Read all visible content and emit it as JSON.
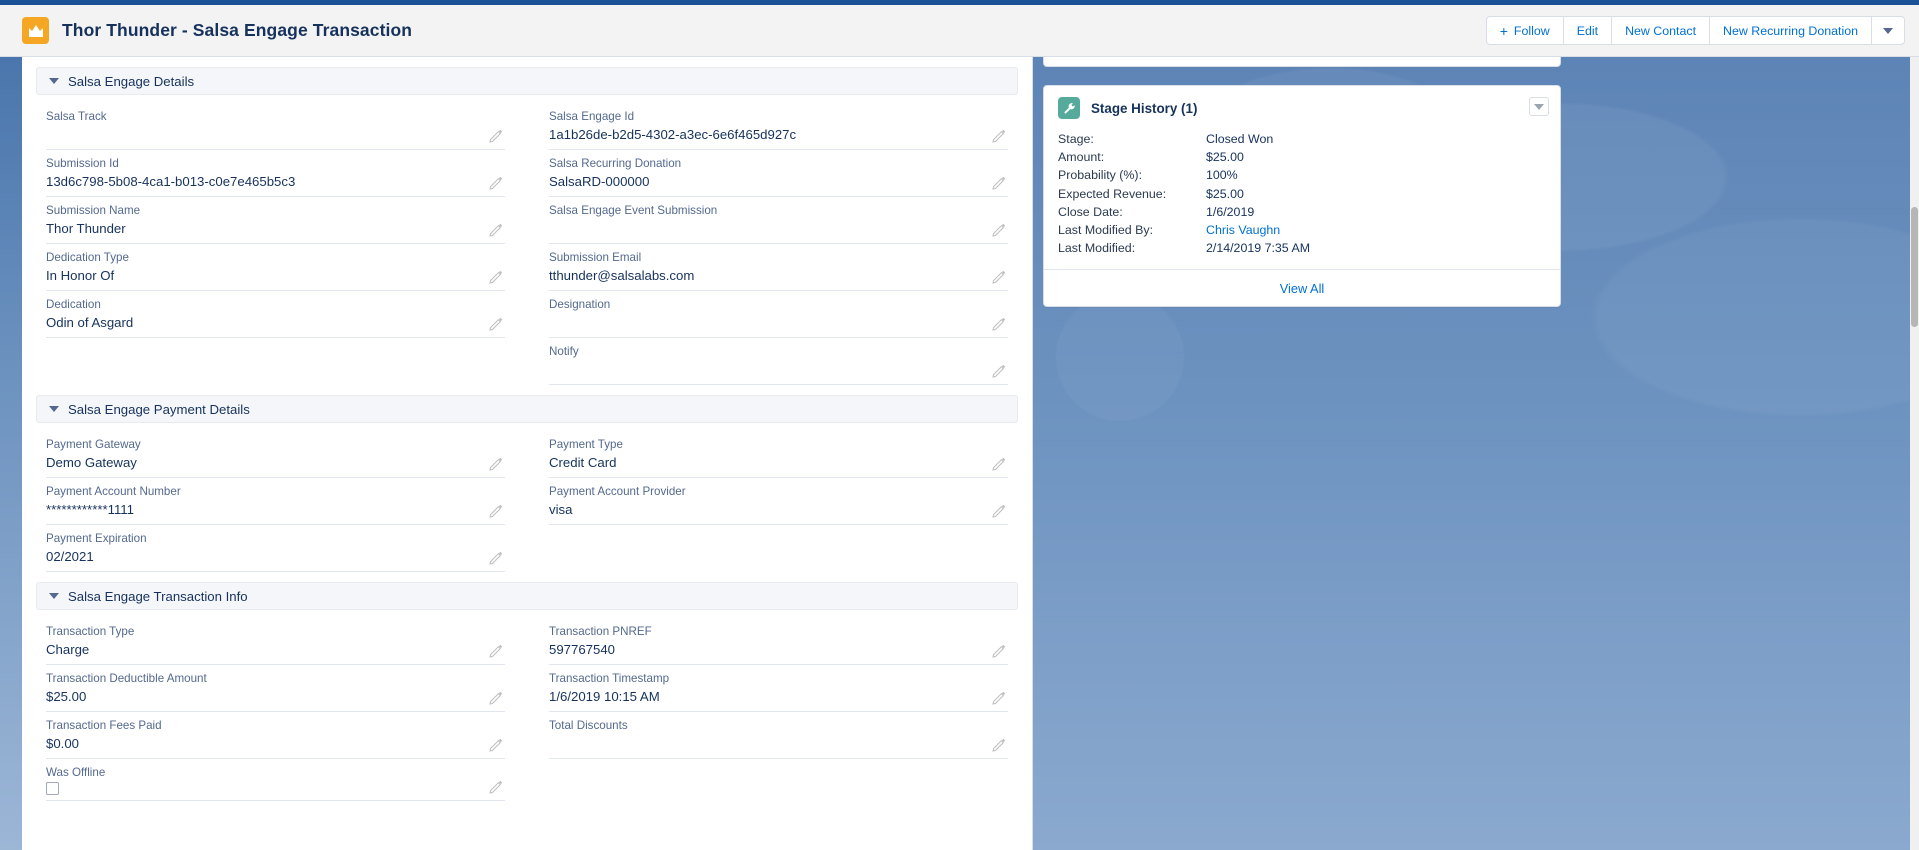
{
  "header": {
    "record_icon": "crown-icon",
    "title": "Thor Thunder - Salsa Engage Transaction",
    "actions": [
      {
        "name": "follow",
        "label": "Follow",
        "icon": "plus-icon"
      },
      {
        "name": "edit",
        "label": "Edit"
      },
      {
        "name": "new-contact",
        "label": "New Contact"
      },
      {
        "name": "new-recurring-donation",
        "label": "New Recurring Donation"
      }
    ],
    "more_actions_icon": "chevron-down-icon"
  },
  "sections": [
    {
      "name": "salsa-engage-details",
      "title": "Salsa Engage Details",
      "collapse_icon": "chevron-down-icon",
      "left": [
        {
          "label": "Salsa Track",
          "value": ""
        },
        {
          "label": "Submission Id",
          "value": "13d6c798-5b08-4ca1-b013-c0e7e465b5c3"
        },
        {
          "label": "Submission Name",
          "value": "Thor Thunder"
        },
        {
          "label": "Dedication Type",
          "value": "In Honor Of"
        },
        {
          "label": "Dedication",
          "value": "Odin of Asgard"
        }
      ],
      "right": [
        {
          "label": "Salsa Engage Id",
          "value": "1a1b26de-b2d5-4302-a3ec-6e6f465d927c"
        },
        {
          "label": "Salsa Recurring Donation",
          "value": "SalsaRD-000000",
          "type": "link"
        },
        {
          "label": "Salsa Engage Event Submission",
          "value": ""
        },
        {
          "label": "Submission Email",
          "value": "tthunder@salsalabs.com"
        },
        {
          "label": "Designation",
          "value": ""
        },
        {
          "label": "Notify",
          "value": ""
        }
      ]
    },
    {
      "name": "salsa-engage-payment-details",
      "title": "Salsa Engage Payment Details",
      "collapse_icon": "chevron-down-icon",
      "left": [
        {
          "label": "Payment Gateway",
          "value": "Demo Gateway"
        },
        {
          "label": "Payment Account Number",
          "value": "************1111"
        },
        {
          "label": "Payment Expiration",
          "value": "02/2021"
        }
      ],
      "right": [
        {
          "label": "Payment Type",
          "value": "Credit Card"
        },
        {
          "label": "Payment Account Provider",
          "value": "visa"
        }
      ]
    },
    {
      "name": "salsa-engage-transaction-info",
      "title": "Salsa Engage Transaction Info",
      "collapse_icon": "chevron-down-icon",
      "left": [
        {
          "label": "Transaction Type",
          "value": "Charge"
        },
        {
          "label": "Transaction Deductible Amount",
          "value": "$25.00"
        },
        {
          "label": "Transaction Fees Paid",
          "value": "$0.00"
        },
        {
          "label": "Was Offline",
          "value": "",
          "type": "checkbox",
          "checked": false
        }
      ],
      "right": [
        {
          "label": "Transaction PNREF",
          "value": "597767540"
        },
        {
          "label": "Transaction Timestamp",
          "value": "1/6/2019 10:15 AM"
        },
        {
          "label": "Total Discounts",
          "value": ""
        }
      ]
    }
  ],
  "stage_history": {
    "icon": "wrench-icon",
    "title": "Stage History (1)",
    "menu_icon": "chevron-down-icon",
    "rows": [
      {
        "key": "Stage:",
        "value": "Closed Won"
      },
      {
        "key": "Amount:",
        "value": "$25.00"
      },
      {
        "key": "Probability (%):",
        "value": "100%"
      },
      {
        "key": "Expected Revenue:",
        "value": "$25.00"
      },
      {
        "key": "Close Date:",
        "value": "1/6/2019"
      },
      {
        "key": "Last Modified By:",
        "value": "Chris Vaughn",
        "type": "link"
      },
      {
        "key": "Last Modified:",
        "value": "2/14/2019 7:35 AM"
      }
    ],
    "view_all_label": "View All"
  },
  "colors": {
    "brand_blue": "#1b5297",
    "link": "#0070d2",
    "record_icon_bg": "#f5a623",
    "stage_icon_bg": "#56aa9b",
    "label_text": "#54698d",
    "value_text": "#16325c"
  }
}
